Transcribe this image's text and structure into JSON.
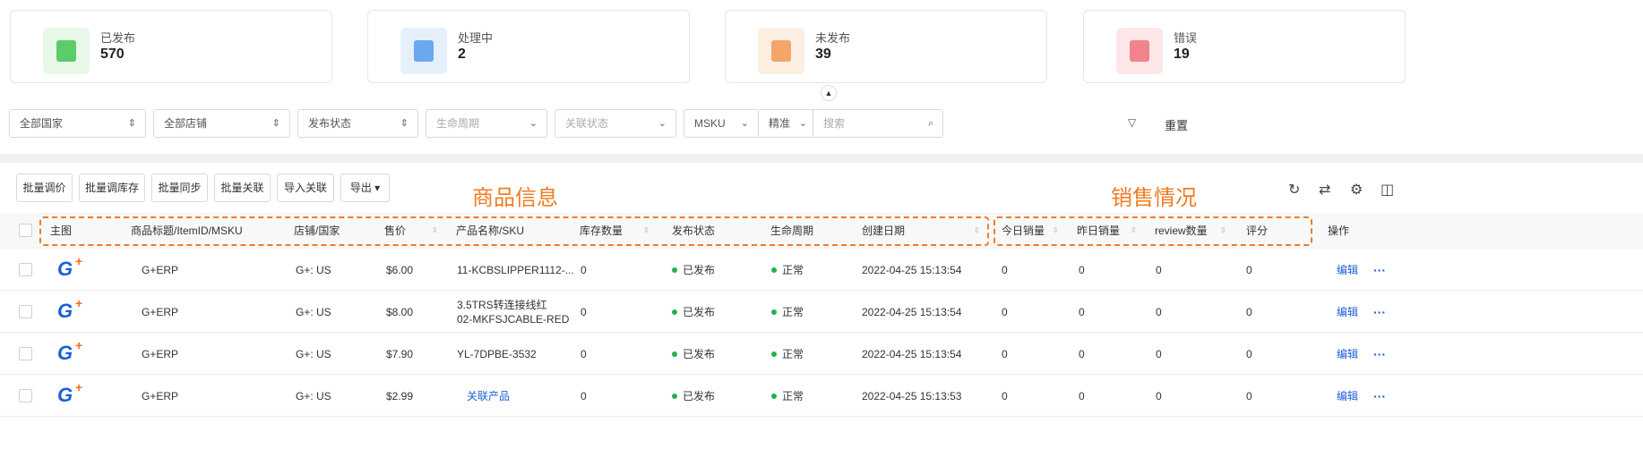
{
  "stats": [
    {
      "label": "已发布",
      "value": "570",
      "color": "#e8f8e9",
      "icon_color": "#5ccb6a",
      "icon": "published-icon"
    },
    {
      "label": "处理中",
      "value": "2",
      "color": "#e6f0fd",
      "icon_color": "#6aa8ef",
      "icon": "processing-icon"
    },
    {
      "label": "未发布",
      "value": "39",
      "color": "#fdeee2",
      "icon_color": "#f5a46a",
      "icon": "unpublished-icon"
    },
    {
      "label": "错误",
      "value": "19",
      "color": "#fde6e8",
      "icon_color": "#f2838c",
      "icon": "error-icon"
    }
  ],
  "filters": {
    "country": "全部国家",
    "store": "全部店铺",
    "publish_status": "发布状态",
    "lifecycle": "生命周期",
    "link_status": "关联状态",
    "field": "MSKU",
    "match": "精准",
    "search_placeholder": "搜索",
    "reset": "重置"
  },
  "toolbar": {
    "buttons": [
      "批量调价",
      "批量调库存",
      "批量同步",
      "批量关联",
      "导入关联",
      "导出 ▾"
    ]
  },
  "annotations": {
    "product_info": "商品信息",
    "sales_info": "销售情况"
  },
  "columns": {
    "main_image": "主图",
    "title": "商品标题/ItemID/MSKU",
    "store": "店铺/国家",
    "price": "售价",
    "product": "产品名称/SKU",
    "stock": "库存数量",
    "publish": "发布状态",
    "lifecycle": "生命周期",
    "created": "创建日期",
    "today_sales": "今日销量",
    "yesterday_sales": "昨日销量",
    "reviews": "review数量",
    "rating": "评分",
    "actions": "操作"
  },
  "rows": [
    {
      "title": "G+ERP",
      "store": "G+: US",
      "price": "$6.00",
      "product": "11-KCBSLIPPER1112-...",
      "product2": "",
      "stock": "0",
      "publish": "已发布",
      "lifecycle": "正常",
      "created": "2022-04-25 15:13:54",
      "today": "0",
      "yesterday": "0",
      "reviews": "0",
      "rating": "0",
      "edit": "编辑",
      "more": "···"
    },
    {
      "title": "G+ERP",
      "store": "G+: US",
      "price": "$8.00",
      "product": "3.5TRS转连接线红",
      "product2": "02-MKFSJCABLE-RED",
      "stock": "0",
      "publish": "已发布",
      "lifecycle": "正常",
      "created": "2022-04-25 15:13:54",
      "today": "0",
      "yesterday": "0",
      "reviews": "0",
      "rating": "0",
      "edit": "编辑",
      "more": "···"
    },
    {
      "title": "G+ERP",
      "store": "G+: US",
      "price": "$7.90",
      "product": "YL-7DPBE-3532",
      "product2": "",
      "stock": "0",
      "publish": "已发布",
      "lifecycle": "正常",
      "created": "2022-04-25 15:13:54",
      "today": "0",
      "yesterday": "0",
      "reviews": "0",
      "rating": "0",
      "edit": "编辑",
      "more": "···"
    },
    {
      "title": "G+ERP",
      "store": "G+: US",
      "price": "$2.99",
      "product": "关联产品",
      "product2": "",
      "stock": "0",
      "publish": "已发布",
      "lifecycle": "正常",
      "created": "2022-04-25 15:13:53",
      "today": "0",
      "yesterday": "0",
      "reviews": "0",
      "rating": "0",
      "edit": "编辑",
      "more": "···"
    }
  ],
  "logo_text": "G",
  "logo_plus": "+"
}
